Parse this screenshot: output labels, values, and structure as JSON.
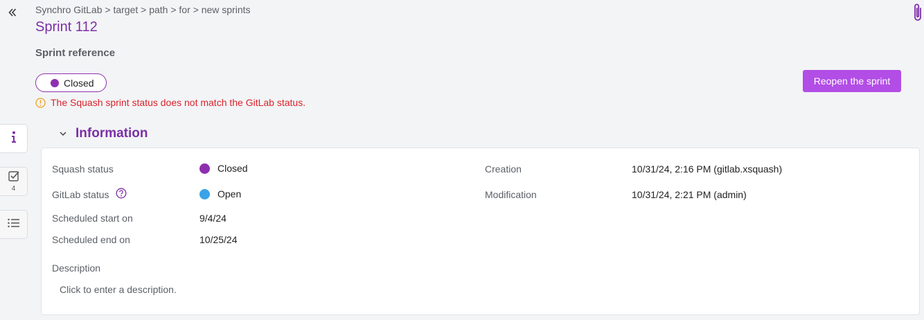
{
  "breadcrumb": "Synchro GitLab > target > path > for > new sprints",
  "page": {
    "title": "Sprint 112",
    "subtitle": "Sprint reference"
  },
  "status_pill": {
    "label": "Closed",
    "color": "#8e2fb0"
  },
  "warning": "The Squash sprint status does not match the GitLab status.",
  "actions": {
    "reopen": "Reopen the sprint"
  },
  "side_tabs": [
    {
      "icon": "info-icon"
    },
    {
      "icon": "checkbox-icon",
      "count": "4"
    },
    {
      "icon": "list-icon"
    }
  ],
  "section": {
    "title": "Information"
  },
  "info": {
    "squash_status_label": "Squash status",
    "squash_status_value": "Closed",
    "squash_status_color": "#8e2fb0",
    "gitlab_status_label": "GitLab status",
    "gitlab_status_value": "Open",
    "gitlab_status_color": "#3aa2e6",
    "start_label": "Scheduled start on",
    "start_value": "9/4/24",
    "end_label": "Scheduled end on",
    "end_value": "10/25/24",
    "creation_label": "Creation",
    "creation_value": "10/31/24, 2:16 PM (gitlab.xsquash)",
    "modification_label": "Modification",
    "modification_value": "10/31/24, 2:21 PM (admin)",
    "description_label": "Description",
    "description_placeholder": "Click to enter a description."
  },
  "colors": {
    "accent": "#7b2fa6",
    "button": "#b24de6",
    "warning_text": "#d9242b",
    "warning_icon": "#f0a020"
  }
}
